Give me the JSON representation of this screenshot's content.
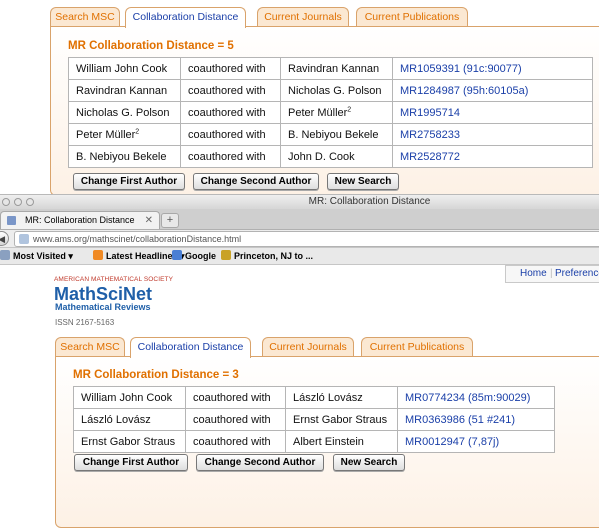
{
  "top_view": {
    "tabs": [
      "Search MSC",
      "Collaboration Distance",
      "Current Journals",
      "Current Publications"
    ],
    "distance_title": "MR Collaboration Distance = 5",
    "rows": [
      {
        "a": "William John Cook",
        "rel": "coauthored with",
        "b": "Ravindran Kannan",
        "mr": "MR1059391 (91c:90077)"
      },
      {
        "a": "Ravindran Kannan",
        "rel": "coauthored with",
        "b": "Nicholas G. Polson",
        "mr": "MR1284987 (95h:60105a)"
      },
      {
        "a": "Nicholas G. Polson",
        "rel": "coauthored with",
        "b": "Peter Müller",
        "b_sup": "2",
        "mr": "MR1995714"
      },
      {
        "a": "Peter Müller",
        "a_sup": "2",
        "rel": "coauthored with",
        "b": "B. Nebiyou Bekele",
        "mr": "MR2758233"
      },
      {
        "a": "B. Nebiyou Bekele",
        "rel": "coauthored with",
        "b": "John D. Cook",
        "mr": "MR2528772"
      }
    ],
    "buttons": [
      "Change First Author",
      "Change Second Author",
      "New Search"
    ]
  },
  "browser": {
    "window_title": "MR: Collaboration Distance",
    "tab_title": "MR: Collaboration Distance",
    "tab_close": "✕",
    "new_tab": "+",
    "url": "www.ams.org/mathscinet/collaborationDistance.html",
    "bookmarks": [
      "Most Visited ▾",
      "Latest Headlines ▾",
      "Google",
      "Princeton, NJ to ..."
    ]
  },
  "page": {
    "society": "AMERICAN MATHEMATICAL SOCIETY",
    "logo": "MathSciNet",
    "subtitle": "Mathematical Reviews",
    "issn": "ISSN 2167-5163",
    "nav": [
      "Home",
      "Preferences"
    ],
    "tabs": [
      "Search MSC",
      "Collaboration Distance",
      "Current Journals",
      "Current Publications"
    ],
    "distance_title": "MR Collaboration Distance = 3",
    "rows": [
      {
        "a": "William John Cook",
        "rel": "coauthored with",
        "b": "László Lovász",
        "mr": "MR0774234 (85m:90029)"
      },
      {
        "a": "László Lovász",
        "rel": "coauthored with",
        "b": "Ernst Gabor Straus",
        "mr": "MR0363986 (51 #241)"
      },
      {
        "a": "Ernst Gabor Straus",
        "rel": "coauthored with",
        "b": "Albert Einstein",
        "mr": "MR0012947 (7,87j)"
      }
    ],
    "buttons": [
      "Change First Author",
      "Change Second Author",
      "New Search"
    ]
  },
  "colors": {
    "accent_orange": "#e07000",
    "link_blue": "#1a3fa8",
    "logo_blue": "#1f5fa8"
  }
}
